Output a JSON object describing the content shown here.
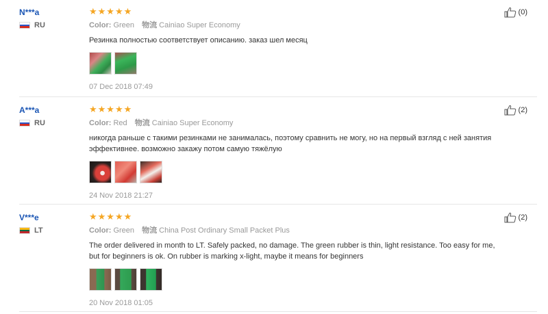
{
  "reviews": [
    {
      "user": "N***a",
      "country": "RU",
      "stars": "★★★★★",
      "color_label": "Color:",
      "color": "Green",
      "shipping_label": "物流",
      "shipping": "Cainiao Super Economy",
      "text": "Резинка полностью соответствует описанию. заказ шел месяц",
      "date": "07 Dec 2018 07:49",
      "helpful": "(0)",
      "photo_count": 2
    },
    {
      "user": "A***a",
      "country": "RU",
      "stars": "★★★★★",
      "color_label": "Color:",
      "color": "Red",
      "shipping_label": "物流",
      "shipping": "Cainiao Super Economy",
      "text": "никогда раньше с такими резинками не занималась, поэтому сравнить не могу, но на первый взгляд с ней занятия эффективнее. возможно закажу потом самую тяжёлую",
      "date": "24 Nov 2018 21:27",
      "helpful": "(2)",
      "photo_count": 3
    },
    {
      "user": "V***e",
      "country": "LT",
      "stars": "★★★★★",
      "color_label": "Color:",
      "color": "Green",
      "shipping_label": "物流",
      "shipping": "China Post Ordinary Small Packet Plus",
      "text": "The order delivered in month to LT. Safely packed, no damage. The green rubber is thin, light resistance. Too easy for me, but for beginners is ok. On rubber is marking x-light, maybe it means for beginners",
      "date": "20 Nov 2018 01:05",
      "helpful": "(2)",
      "photo_count": 3
    }
  ],
  "colors": {
    "username": "#1a55b4",
    "star": "#f5a623",
    "muted": "#999999",
    "separator": "#e6e6e6"
  },
  "icons": {
    "helpful": "thumbs-up-icon",
    "flag_ru": "russia-flag-icon",
    "flag_lt": "lithuania-flag-icon"
  }
}
